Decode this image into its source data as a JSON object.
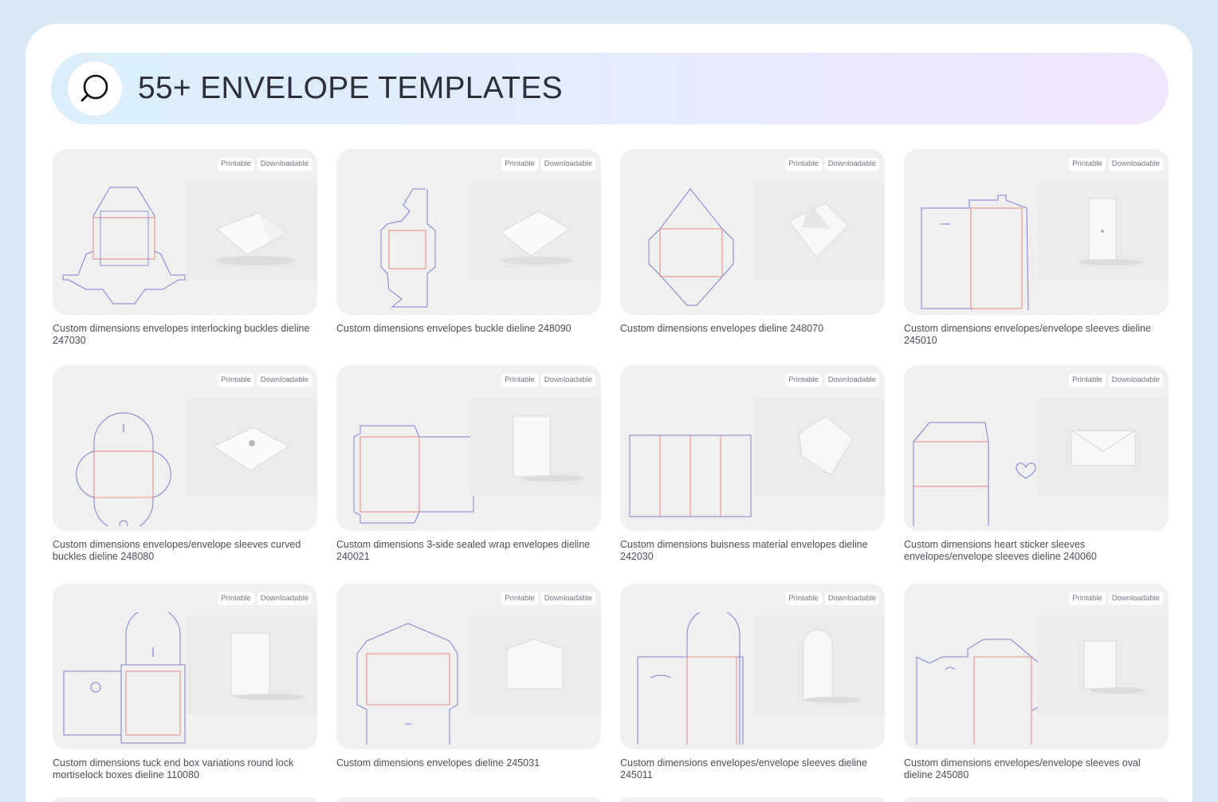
{
  "header": {
    "title": "55+ ENVELOPE TEMPLATES",
    "search_icon": "search-icon"
  },
  "badges": {
    "printable": "Printable",
    "downloadable": "Downloadable"
  },
  "templates": [
    {
      "caption": "Custom dimensions envelopes interlocking buckles dieline 247030"
    },
    {
      "caption": "Custom dimensions envelopes buckle dieline 248090"
    },
    {
      "caption": "Custom dimensions envelopes dieline 248070"
    },
    {
      "caption": "Custom dimensions envelopes/envelope sleeves dieline 245010"
    },
    {
      "caption": "Custom dimensions envelopes/envelope sleeves curved buckles dieline 248080"
    },
    {
      "caption": "Custom dimensions 3-side sealed wrap envelopes dieline 240021"
    },
    {
      "caption": "Custom dimensions buisness material envelopes dieline 242030"
    },
    {
      "caption": "Custom dimensions heart sticker sleeves envelopes/envelope sleeves dieline 240060"
    },
    {
      "caption": "Custom dimensions tuck end box variations round lock mortiselock boxes dieline 110080"
    },
    {
      "caption": "Custom dimensions envelopes dieline 245031"
    },
    {
      "caption": "Custom dimensions envelopes/envelope sleeves dieline 245011"
    },
    {
      "caption": "Custom dimensions envelopes/envelope sleeves oval dieline 245080"
    }
  ]
}
